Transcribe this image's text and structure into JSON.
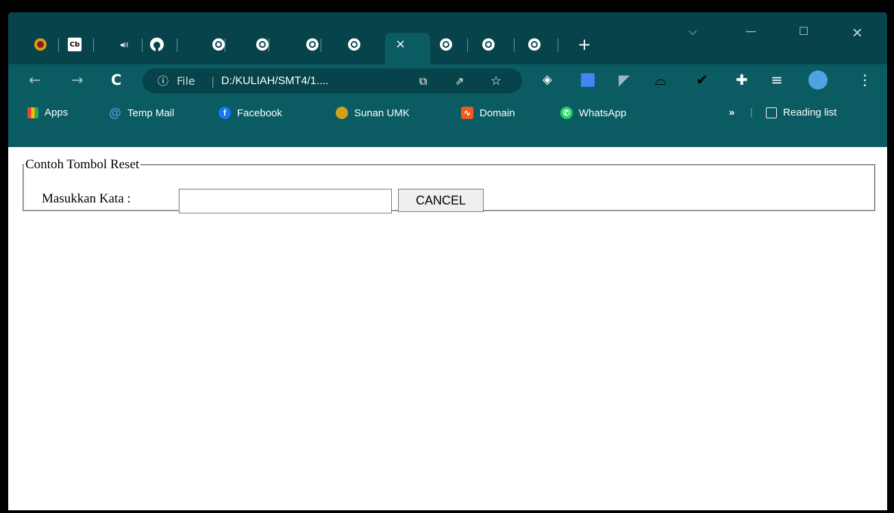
{
  "address_bar": {
    "scheme": "File",
    "url": "D:/KULIAH/SMT4/1...."
  },
  "bookmarks": [
    {
      "label": "Apps",
      "icon": "apps-grid-icon"
    },
    {
      "label": "Temp Mail",
      "icon": "at-icon"
    },
    {
      "label": "Facebook",
      "icon": "facebook-icon"
    },
    {
      "label": "Sunan UMK",
      "icon": "umk-logo-icon"
    },
    {
      "label": "Domain",
      "icon": "domain-icon"
    },
    {
      "label": "WhatsApp",
      "icon": "whatsapp-icon"
    }
  ],
  "reading_list": "Reading list",
  "form": {
    "legend": "Contoh Tombol Reset",
    "label": "Masukkan Kata :",
    "input_value": "",
    "button": "CANCEL"
  },
  "colors": {
    "tabbar": "#06434a",
    "toolbar": "#0a5b62",
    "page_bg": "#ffffff"
  }
}
